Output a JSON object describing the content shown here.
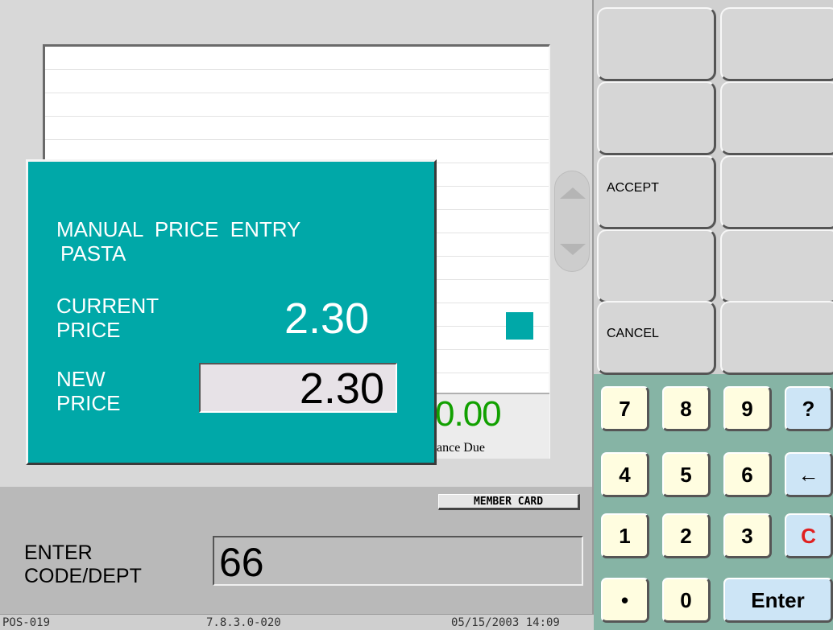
{
  "popup": {
    "title": "MANUAL  PRICE  ENTRY",
    "item": "PASTA",
    "current_label_1": "CURRENT",
    "current_label_2": "PRICE",
    "current_value": "2.30",
    "new_label_1": "NEW",
    "new_label_2": "PRICE",
    "new_value": "2.30"
  },
  "balance": {
    "amount": "0.00",
    "label": "ance Due"
  },
  "member_card_label": "MEMBER CARD",
  "prompt": {
    "label_line1": "ENTER",
    "label_line2": "CODE/DEPT",
    "value": "66"
  },
  "status": {
    "terminal": "POS-019",
    "version": "7.8.3.0-020",
    "datetime": "05/15/2003 14:09"
  },
  "function_keys": [
    "",
    "",
    "",
    "",
    "ACCEPT",
    "",
    "",
    "",
    "CANCEL",
    ""
  ],
  "keypad": {
    "k7": "7",
    "k8": "8",
    "k9": "9",
    "help": "?",
    "k4": "4",
    "k5": "5",
    "k6": "6",
    "back": "←",
    "k1": "1",
    "k2": "2",
    "k3": "3",
    "clear": "C",
    "dot": "•",
    "k0": "0",
    "enter": "Enter"
  },
  "colors": {
    "popup_bg": "#00a8a8",
    "balance_green": "#11a000",
    "keypad_bg": "#86b4a5",
    "clear_red": "#e02020"
  },
  "icons": {
    "scroll_up": "triangle-up",
    "scroll_down": "triangle-down",
    "backspace": "left-arrow"
  }
}
